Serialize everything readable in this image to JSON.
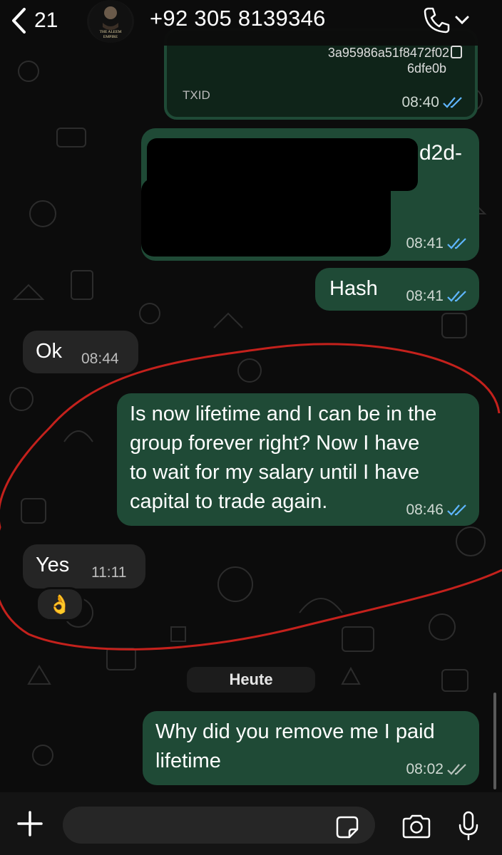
{
  "header": {
    "back_count": "21",
    "contact_name": "+92 305 8139346",
    "avatar_text_line1": "THE ALEEM",
    "avatar_text_line2": "EMPIRE"
  },
  "messages": {
    "txid_hash_line1": "3a95986a51f8472f02",
    "txid_hash_line2": "6dfe0b",
    "txid_label": "TXID",
    "txid_time": "08:40",
    "redacted_visible": "d2d-",
    "redacted_time": "08:41",
    "hash_text": "Hash",
    "hash_time": "08:41",
    "ok_text": "Ok",
    "ok_time": "08:44",
    "lifetime_line1": "Is now lifetime and I can be in the",
    "lifetime_line2": "group forever right? Now I have",
    "lifetime_line3": "to wait for my salary until I have",
    "lifetime_line4": "capital to trade again.",
    "lifetime_time": "08:46",
    "yes_text": "Yes",
    "yes_time": "11:11",
    "yes_reaction": "👌",
    "date_separator": "Heute",
    "remove_line1": "Why did you remove me I paid",
    "remove_line2": "lifetime",
    "remove_time": "08:02"
  },
  "colors": {
    "outgoing_bubble": "#1f4a36",
    "incoming_bubble": "#252525",
    "read_ticks": "#5fb6ff",
    "delivered_ticks": "#b8c2bc",
    "annotation": "#c4211c"
  },
  "input": {
    "placeholder": ""
  }
}
